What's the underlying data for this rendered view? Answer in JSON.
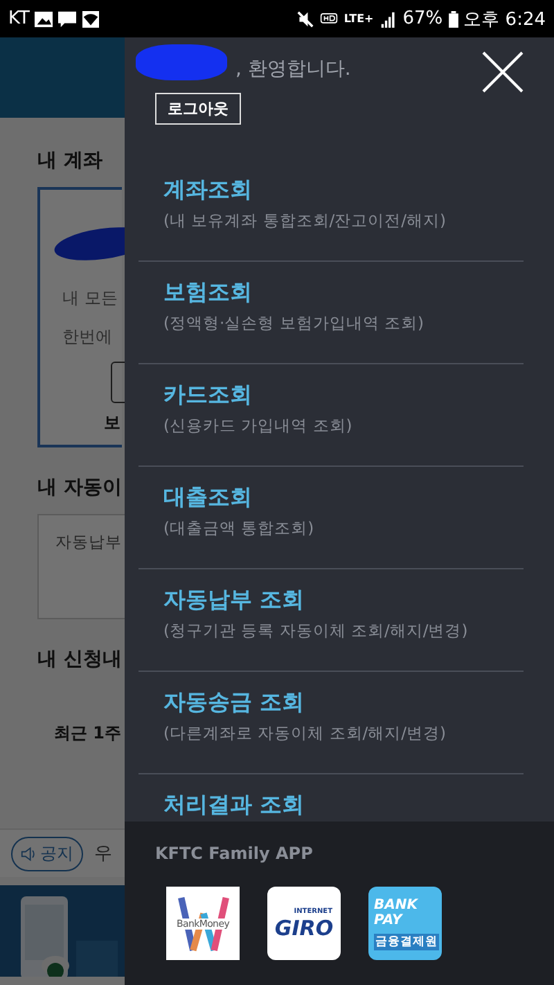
{
  "status_bar": {
    "carrier": "KT",
    "network": "LTE+",
    "battery": "67%",
    "time": "오후 6:24"
  },
  "background_page": {
    "section_1": "내 계좌",
    "card_lines": [
      "내 모든",
      "한번에"
    ],
    "card_button": "보",
    "section_2": "내 자동이",
    "auto_box": "자동납부",
    "section_3": "내 신청내",
    "recent": "최근 1주",
    "notice_tag": "공지",
    "notice_text": "우"
  },
  "drawer": {
    "welcome": ", 환영합니다.",
    "logout": "로그아웃",
    "menu": [
      {
        "title": "계좌조회",
        "subtitle": "(내 보유계좌 통합조회/잔고이전/해지)"
      },
      {
        "title": "보험조회",
        "subtitle": "(정액형·실손형 보험가입내역 조회)"
      },
      {
        "title": "카드조회",
        "subtitle": "(신용카드 가입내역 조회)"
      },
      {
        "title": "대출조회",
        "subtitle": "(대출금액 통합조회)"
      },
      {
        "title": "자동납부 조회",
        "subtitle": "(청구기관 등록 자동이체 조회/해지/변경)"
      },
      {
        "title": "자동송금 조회",
        "subtitle": "(다른계좌로 자동이체 조회/해지/변경)"
      },
      {
        "title": "처리결과 조회"
      }
    ],
    "family_title": "KFTC Family APP",
    "apps": [
      {
        "kind": "bankmoney",
        "label": "BankMoney"
      },
      {
        "kind": "giro",
        "top": "INTERNET",
        "label": "GIRO"
      },
      {
        "kind": "bankpay",
        "label": "BANK PAY",
        "sub": "금융결제원"
      }
    ]
  }
}
